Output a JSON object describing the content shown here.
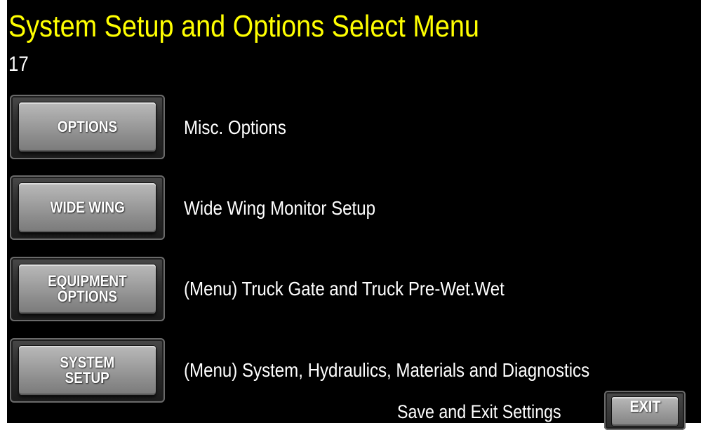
{
  "header": {
    "title": "System Setup and Options Select Menu",
    "screen_number": "17"
  },
  "menu": {
    "items": [
      {
        "button_label": "OPTIONS",
        "description": "Misc. Options"
      },
      {
        "button_label": "WIDE WING",
        "description": "Wide Wing Monitor Setup"
      },
      {
        "button_label": "EQUIPMENT\nOPTIONS",
        "description": "(Menu) Truck Gate and Truck Pre-Wet.Wet"
      },
      {
        "button_label": "SYSTEM\nSETUP",
        "description": "(Menu) System, Hydraulics, Materials and Diagnostics"
      }
    ]
  },
  "footer": {
    "save_text": "Save and Exit Settings",
    "exit_label": "EXIT"
  },
  "colors": {
    "background": "#000000",
    "title": "#ffff00",
    "text": "#ffffff",
    "button_face": "#a3a3a3"
  }
}
